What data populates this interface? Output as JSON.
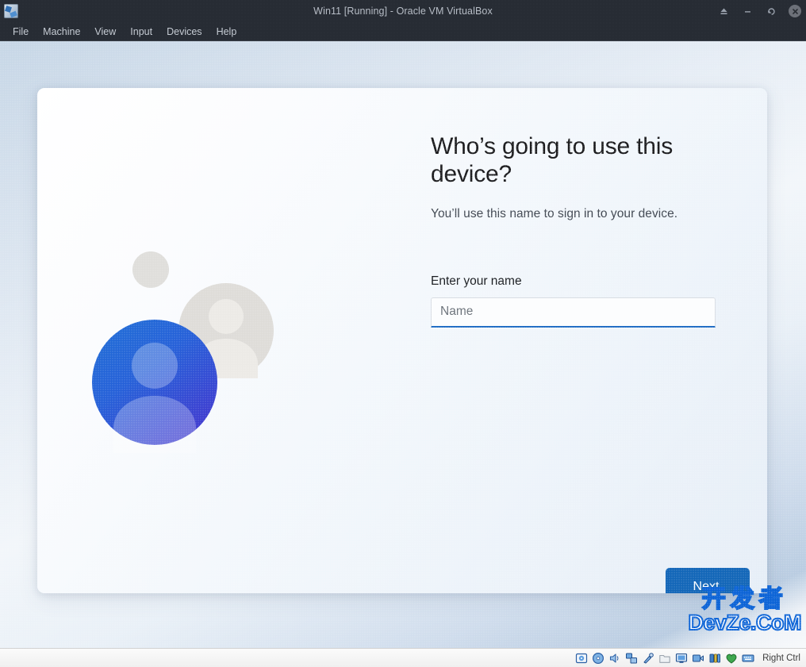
{
  "window": {
    "title": "Win11 [Running] - Oracle VM VirtualBox",
    "app_icon_name": "virtualbox-icon",
    "buttons": [
      {
        "name": "eject-button",
        "label": "Eject"
      },
      {
        "name": "minimize-button",
        "label": "Minimize"
      },
      {
        "name": "restore-button",
        "label": "Restore"
      },
      {
        "name": "close-button",
        "label": "Close"
      }
    ]
  },
  "menubar": {
    "items": [
      {
        "label": "File"
      },
      {
        "label": "Machine"
      },
      {
        "label": "View"
      },
      {
        "label": "Input"
      },
      {
        "label": "Devices"
      },
      {
        "label": "Help"
      }
    ]
  },
  "oobe": {
    "heading": "Who’s going to use this device?",
    "subtitle": "You’ll use this name to sign in to your device.",
    "field_label": "Enter your name",
    "input_value": "",
    "input_placeholder": "Name",
    "next_label": "Next",
    "accent_color": "#1266b8",
    "input_focus_color": "#1f6cc4"
  },
  "statusbar": {
    "icons": [
      {
        "name": "hard-disk-icon"
      },
      {
        "name": "optical-disk-icon"
      },
      {
        "name": "audio-icon"
      },
      {
        "name": "network-icon"
      },
      {
        "name": "usb-icon"
      },
      {
        "name": "shared-folders-icon"
      },
      {
        "name": "display-icon"
      },
      {
        "name": "recording-icon"
      },
      {
        "name": "features-icon"
      },
      {
        "name": "mouse-integration-icon"
      },
      {
        "name": "keyboard-icon"
      }
    ],
    "host_key": "Right Ctrl"
  },
  "watermark": {
    "line1": "开发者",
    "line2": "DevZe.CoM"
  }
}
